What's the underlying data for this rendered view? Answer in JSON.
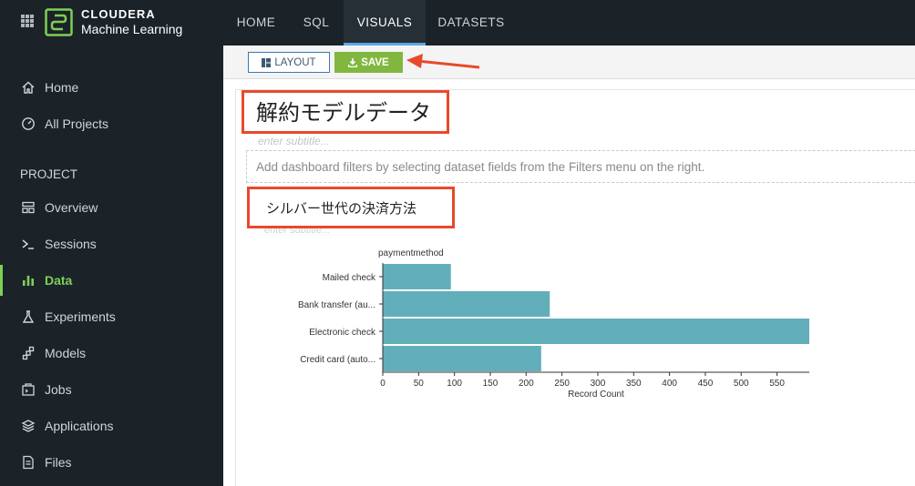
{
  "brand": {
    "name": "CLOUDERA",
    "product": "Machine Learning"
  },
  "sidebar": {
    "top_items": [
      {
        "label": "Home",
        "icon": "home-icon"
      },
      {
        "label": "All Projects",
        "icon": "gauge-icon"
      }
    ],
    "section_label": "PROJECT",
    "items": [
      {
        "label": "Overview",
        "icon": "overview-icon"
      },
      {
        "label": "Sessions",
        "icon": "terminal-icon"
      },
      {
        "label": "Data",
        "icon": "bar-chart-icon",
        "active": true
      },
      {
        "label": "Experiments",
        "icon": "flask-icon"
      },
      {
        "label": "Models",
        "icon": "models-icon"
      },
      {
        "label": "Jobs",
        "icon": "jobs-icon"
      },
      {
        "label": "Applications",
        "icon": "layers-icon"
      },
      {
        "label": "Files",
        "icon": "file-icon"
      }
    ]
  },
  "topnav": {
    "tabs": [
      "HOME",
      "SQL",
      "VISUALS",
      "DATASETS"
    ],
    "active": "VISUALS"
  },
  "toolbar": {
    "layout_label": "LAYOUT",
    "save_label": "SAVE"
  },
  "dashboard": {
    "title": "解約モデルデータ",
    "subtitle_placeholder": "enter subtitle...",
    "filters_hint": "Add dashboard filters by selecting dataset fields from the Filters menu on the right.",
    "visual_title": "シルバー世代の決済方法",
    "visual_subtitle_placeholder": "enter subtitle..."
  },
  "colors": {
    "accent": "#7ed054",
    "bar": "#63aebb",
    "highlight": "#e8492b",
    "save": "#82b73f"
  },
  "chart_data": {
    "type": "bar",
    "orientation": "horizontal",
    "legend_title": "paymentmethod",
    "categories": [
      "Mailed check",
      "Bank transfer (au...",
      "Electronic check",
      "Credit card (auto..."
    ],
    "values": [
      95,
      233,
      595,
      221
    ],
    "xlabel": "Record Count",
    "xlim": [
      0,
      595
    ],
    "xticks": [
      0,
      50,
      100,
      150,
      200,
      250,
      300,
      350,
      400,
      450,
      500,
      550
    ]
  }
}
